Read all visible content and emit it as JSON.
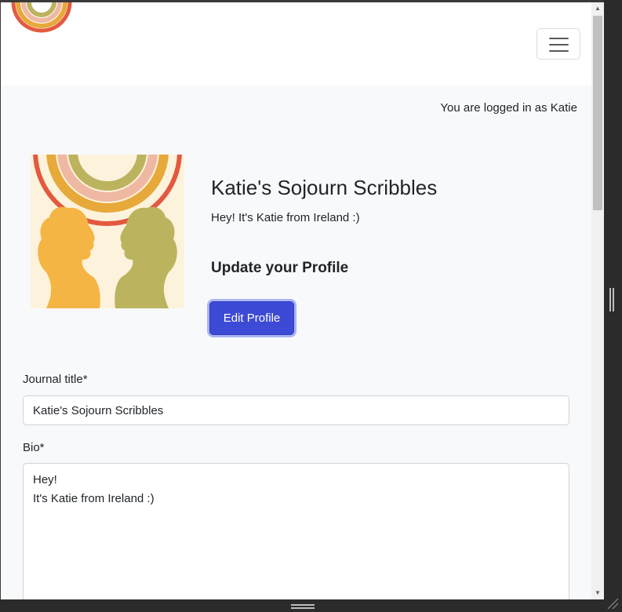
{
  "navbar": {
    "logo_icon": "rainbow-arc-logo",
    "menu_icon": "hamburger-menu-icon"
  },
  "status": {
    "logged_in_text": "You are logged in as Katie"
  },
  "profile": {
    "avatar_icon": "rainbow-silhouettes-image",
    "title": "Katie's Sojourn Scribbles",
    "bio": "Hey! It's Katie from Ireland :)",
    "update_heading": "Update your Profile",
    "edit_button_label": "Edit Profile"
  },
  "form": {
    "title_label": "Journal title*",
    "title_value": "Katie's Sojourn Scribbles",
    "bio_label": "Bio*",
    "bio_value": "Hey!\nIt's Katie from Ireland :)"
  },
  "colors": {
    "primary": "#3d4ad5",
    "page_bg": "#f8f9fa",
    "rainbow_red": "#e3593f",
    "rainbow_gold": "#e6a93a",
    "rainbow_pink": "#efb8a3",
    "rainbow_olive": "#bcb35f",
    "silhouette_left": "#f5b544",
    "silhouette_right": "#bcb35f"
  }
}
